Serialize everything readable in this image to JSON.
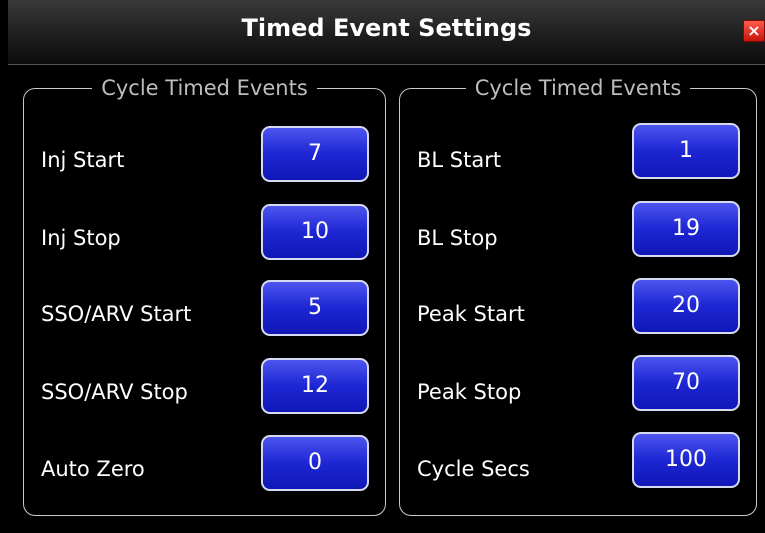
{
  "window": {
    "title": "Timed Event Settings",
    "close_label": "×"
  },
  "left_group": {
    "title": "Cycle Timed Events",
    "rows": [
      {
        "label": "Inj Start",
        "value": "7"
      },
      {
        "label": "Inj Stop",
        "value": "10"
      },
      {
        "label": "SSO/ARV Start",
        "value": "5"
      },
      {
        "label": "SSO/ARV Stop",
        "value": "12"
      },
      {
        "label": "Auto Zero",
        "value": "0"
      }
    ]
  },
  "right_group": {
    "title": "Cycle Timed Events",
    "rows": [
      {
        "label": "BL Start",
        "value": "1"
      },
      {
        "label": "BL Stop",
        "value": "19"
      },
      {
        "label": "Peak Start",
        "value": "20"
      },
      {
        "label": "Peak Stop",
        "value": "70"
      },
      {
        "label": "Cycle Secs",
        "value": "100"
      }
    ]
  },
  "colors": {
    "button_blue": "#1d26d3",
    "close_red": "#e0291a",
    "group_border": "#c9c9c9"
  }
}
